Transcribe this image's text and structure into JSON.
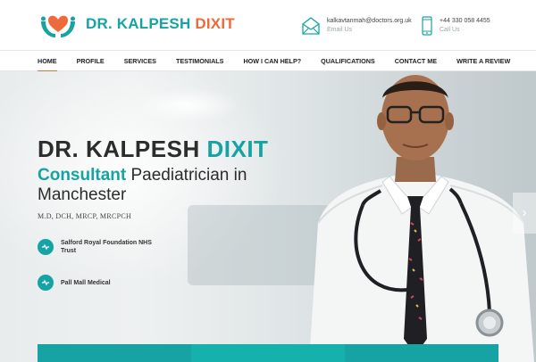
{
  "brand": {
    "name_part1": "DR. KALPESH",
    "name_part2": "DIXIT",
    "teal": "#17a3a3",
    "orange": "#ef6a3a"
  },
  "contact": {
    "email": {
      "icon": "envelope-icon",
      "value": "kalkavtanmah@doctors.org.uk",
      "label": "Email Us"
    },
    "phone": {
      "icon": "mobile-phone-icon",
      "value": "+44 330 058 4455",
      "label": "Call Us"
    }
  },
  "nav": {
    "items": [
      {
        "label": "HOME",
        "active": true
      },
      {
        "label": "PROFILE"
      },
      {
        "label": "SERVICES"
      },
      {
        "label": "TESTIMONIALS"
      },
      {
        "label": "HOW I CAN HELP?"
      },
      {
        "label": "QUALIFICATIONS"
      },
      {
        "label": "CONTACT ME"
      },
      {
        "label": "WRITE A REVIEW"
      }
    ]
  },
  "hero": {
    "title_part1": "DR. KALPESH",
    "title_part2": "DIXIT",
    "subtitle_accent": "Consultant",
    "subtitle_rest": "Paediatrician in Manchester",
    "qualifications": "M.D, DCH, MRCP, MRCPCH",
    "hospitals": [
      {
        "icon": "stethoscope-icon",
        "label": "Salford Royal Foundation NHS Trust"
      },
      {
        "icon": "stethoscope-icon",
        "label": "Pall Mall Medical"
      }
    ],
    "next_icon": "chevron-right-icon"
  }
}
